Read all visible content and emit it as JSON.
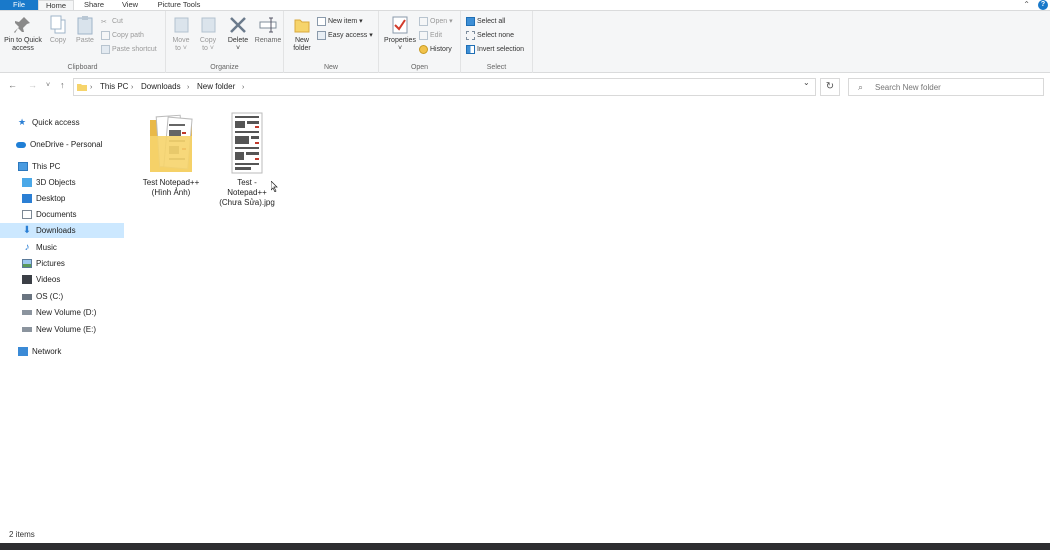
{
  "ribbon_tabs": {
    "file": "File",
    "home": "Home",
    "share": "Share",
    "view": "View",
    "picture_tools": "Picture Tools"
  },
  "ribbon": {
    "clipboard": {
      "label": "Clipboard",
      "pin_line1": "Pin to Quick",
      "pin_line2": "access",
      "copy": "Copy",
      "paste": "Paste",
      "cut": "Cut",
      "copy_path": "Copy path",
      "paste_shortcut": "Paste shortcut"
    },
    "organize": {
      "label": "Organize",
      "move_line1": "Move",
      "move_line2": "to ˅",
      "copy_line1": "Copy",
      "copy_line2": "to ˅",
      "delete": "Delete",
      "delete_arrow": "˅",
      "rename": "Rename"
    },
    "new": {
      "label": "New",
      "folder_line1": "New",
      "folder_line2": "folder",
      "new_item": "New item ▾",
      "easy_access": "Easy access ▾"
    },
    "open": {
      "label": "Open",
      "properties": "Properties",
      "properties_arrow": "˅",
      "open": "Open ▾",
      "edit": "Edit",
      "history": "History"
    },
    "select": {
      "label": "Select",
      "select_all": "Select all",
      "select_none": "Select none",
      "invert_selection": "Invert selection"
    }
  },
  "breadcrumb": {
    "this_pc": "This PC",
    "downloads": "Downloads",
    "new_folder": "New folder"
  },
  "search": {
    "placeholder": "Search New folder"
  },
  "nav": {
    "quick_access": "Quick access",
    "onedrive": "OneDrive - Personal",
    "this_pc": "This PC",
    "objects_3d": "3D Objects",
    "desktop": "Desktop",
    "documents": "Documents",
    "downloads": "Downloads",
    "music": "Music",
    "pictures": "Pictures",
    "videos": "Videos",
    "os_c": "OS (C:)",
    "vol_d": "New Volume (D:)",
    "vol_e": "New Volume (E:)",
    "network": "Network"
  },
  "files": [
    {
      "line1": "Test Notepad++",
      "line2": "(Hình Ảnh)",
      "line3": ""
    },
    {
      "line1": "Test -",
      "line2": "Notepad++",
      "line3": "(Chưa Sửa).jpg"
    }
  ],
  "status": {
    "items": "2 items"
  },
  "colors": {
    "accent": "#1979ca",
    "selected": "#cce8ff",
    "folder": "#f6d46b"
  }
}
